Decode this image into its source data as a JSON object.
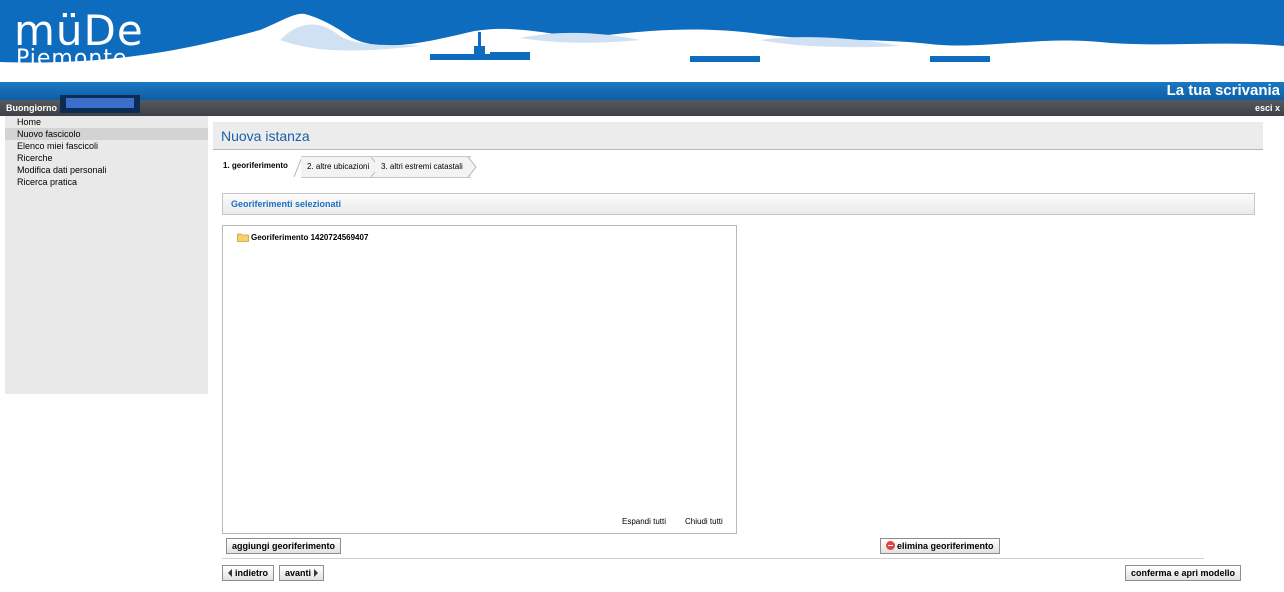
{
  "header": {
    "logo_top": "müDe",
    "logo_bottom": "Piemonte",
    "page_heading": "La tua scrivania",
    "greeting": "Buongiorno",
    "logout": "esci x"
  },
  "sidebar": {
    "items": [
      {
        "label": "Home"
      },
      {
        "label": "Nuovo fascicolo"
      },
      {
        "label": "Elenco miei fascicoli"
      },
      {
        "label": "Ricerche"
      },
      {
        "label": "Modifica dati personali"
      },
      {
        "label": "Ricerca pratica"
      }
    ]
  },
  "main": {
    "title": "Nuova istanza",
    "tabs": [
      {
        "label": "1. georiferimento"
      },
      {
        "label": "2. altre ubicazioni"
      },
      {
        "label": "3. altri estremi catastali"
      }
    ],
    "section_title": "Georiferimenti selezionati",
    "tree": {
      "node_label": "Georiferimento 1420724569407",
      "expand_all": "Espandi tutti",
      "collapse_all": "Chiudi tutti"
    },
    "buttons": {
      "add": "aggiungi georiferimento",
      "delete": "elimina georiferimento",
      "back": "indietro",
      "next": "avanti",
      "confirm": "conferma e apri modello"
    }
  },
  "colors": {
    "banner_blue": "#0f6cc0",
    "title_band": "#1a78c2",
    "user_bar": "#4a4d52",
    "section_title_text": "#1a6fbf"
  }
}
